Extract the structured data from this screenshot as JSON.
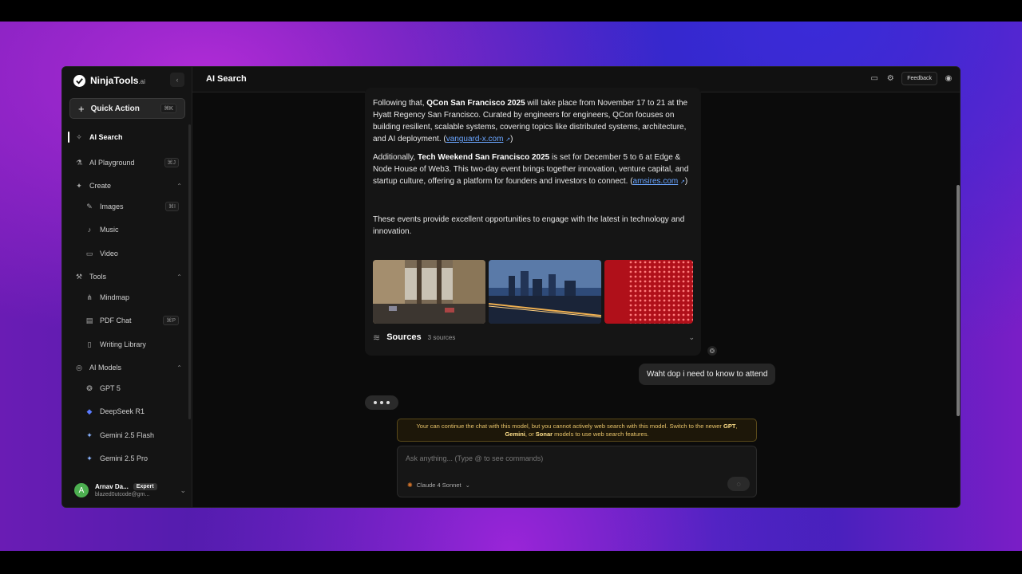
{
  "app": {
    "logo_text": "NinjaTools",
    "logo_suffix": ".ai",
    "header_title": "AI Search"
  },
  "sidebar": {
    "quick_action": {
      "label": "Quick Action",
      "shortcut": "⌘K"
    },
    "items": [
      {
        "label": "AI Search",
        "icon": "sparkle-icon",
        "active": true
      },
      {
        "label": "AI Playground",
        "icon": "flask-icon",
        "shortcut": "⌘J"
      },
      {
        "label": "Create",
        "icon": "sparkles-icon",
        "section": true
      },
      {
        "label": "Images",
        "icon": "brush-icon",
        "shortcut": "⌘I"
      },
      {
        "label": "Music",
        "icon": "music-icon"
      },
      {
        "label": "Video",
        "icon": "video-icon"
      },
      {
        "label": "Tools",
        "icon": "wrench-icon",
        "section": true
      },
      {
        "label": "Mindmap",
        "icon": "mindmap-icon"
      },
      {
        "label": "PDF Chat",
        "icon": "pdf-icon",
        "shortcut": "⌘P"
      },
      {
        "label": "Writing Library",
        "icon": "book-icon"
      },
      {
        "label": "AI Models",
        "icon": "models-icon",
        "section": true
      },
      {
        "label": "GPT 5",
        "icon": "openai-icon"
      },
      {
        "label": "DeepSeek R1",
        "icon": "deepseek-icon"
      },
      {
        "label": "Gemini 2.5 Flash",
        "icon": "gemini-icon"
      },
      {
        "label": "Gemini 2.5 Pro",
        "icon": "gemini-icon"
      }
    ],
    "user": {
      "avatar_letter": "A",
      "name": "Arnav Da...",
      "badge": "Expert",
      "email": "blazed0utcode@gm..."
    }
  },
  "header": {
    "feedback": "Feedback"
  },
  "answer": {
    "p1_pre": "Following that, ",
    "p1_bold": "QCon San Francisco 2025",
    "p1_post": " will take place from November 17 to 21 at the Hyatt Regency San Francisco. Curated by engineers for engineers, QCon focuses on building resilient, scalable systems, covering topics like distributed systems, architecture, and AI deployment. (",
    "p1_link": "vanguard-x.com",
    "p1_end": ")",
    "p2_pre": "Additionally, ",
    "p2_bold": "Tech Weekend San Francisco 2025",
    "p2_post": " is set for December 5 to 6 at Edge & Node House of Web3. This two-day event brings together innovation, venture capital, and startup culture, offering a platform for founders and investors to connect. (",
    "p2_link": "amsires.com",
    "p2_end": ")",
    "p3": "These events provide excellent opportunities to engage with the latest in technology and innovation.",
    "sources_label": "Sources",
    "sources_count": "3 sources"
  },
  "chat": {
    "user_message": "Waht dop i need to know to attend"
  },
  "warning": {
    "pre": "Your can continue the chat with this model, but you cannot actively web search with this model. Switch to the newer ",
    "gpt": "GPT",
    "mid1": ", ",
    "gemini": "Gemini",
    "mid2": ", or ",
    "sonar": "Sonar",
    "post": " models to use web search features."
  },
  "composer": {
    "placeholder": "Ask anything... (Type @ to see commands)",
    "model": "Claude 4 Sonnet"
  }
}
